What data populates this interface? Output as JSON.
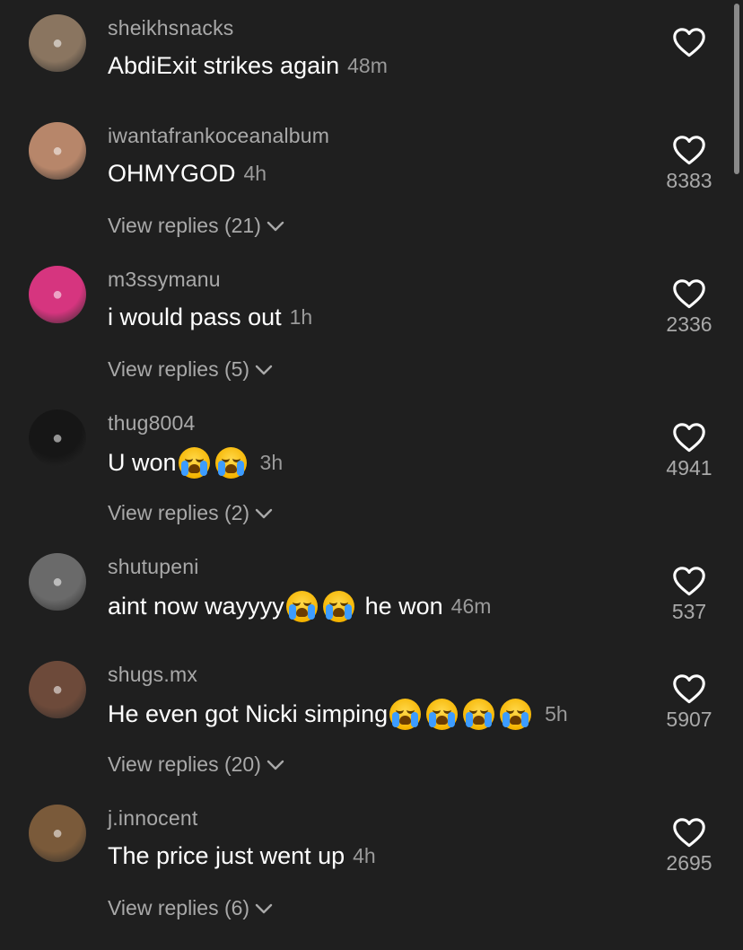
{
  "comments": [
    {
      "username": "sheikhsnacks",
      "text": "AbdiExit strikes again",
      "emojis": [],
      "text_after": "",
      "time": "48m",
      "likes": "",
      "replies": "",
      "avatar_icon": "avatar-food-icon",
      "avatar_color": "#8a7560"
    },
    {
      "username": "iwantafrankoceanalbum",
      "text": "OHMYGOD",
      "emojis": [],
      "text_after": "",
      "time": "4h",
      "likes": "8383",
      "replies": "View replies (21)",
      "avatar_icon": "avatar-person-icon",
      "avatar_color": "#b7866a"
    },
    {
      "username": "m3ssymanu",
      "text": "i would pass out",
      "emojis": [],
      "text_after": "",
      "time": "1h",
      "likes": "2336",
      "replies": "View replies (5)",
      "avatar_icon": "avatar-person-icon",
      "avatar_color": "#d6357f"
    },
    {
      "username": "thug8004",
      "text": "U won",
      "emojis": [
        "loudly-crying-face",
        "loudly-crying-face"
      ],
      "text_after": "",
      "time": "3h",
      "likes": "4941",
      "replies": "View replies (2)",
      "avatar_icon": "avatar-anime-icon",
      "avatar_color": "#161616"
    },
    {
      "username": "shutupeni",
      "text": "aint now wayyyy",
      "emojis": [
        "loudly-crying-face",
        "loudly-crying-face"
      ],
      "text_after": "he won",
      "time": "46m",
      "likes": "537",
      "replies": "",
      "avatar_icon": "avatar-person-icon",
      "avatar_color": "#6a6a6a"
    },
    {
      "username": "shugs.mx",
      "text": "He even got Nicki simping",
      "emojis": [
        "loudly-crying-face",
        "loudly-crying-face",
        "loudly-crying-face",
        "loudly-crying-face"
      ],
      "text_after": "",
      "time": "5h",
      "likes": "5907",
      "replies": "View replies (20)",
      "avatar_icon": "avatar-person-icon",
      "avatar_color": "#6d4a3a"
    },
    {
      "username": "j.innocent",
      "text": "The price just went up",
      "emojis": [],
      "text_after": "",
      "time": "4h",
      "likes": "2695",
      "replies": "View replies (6)",
      "avatar_icon": "avatar-person-icon",
      "avatar_color": "#7a5a3a"
    }
  ],
  "colors": {
    "background": "#1f1f1f",
    "text_primary": "#ffffff",
    "text_secondary": "#a9a9a9"
  },
  "icons": {
    "like": "heart-outline-icon",
    "expand": "chevron-down-icon",
    "emoji": "loudly-crying-face-emoji"
  }
}
